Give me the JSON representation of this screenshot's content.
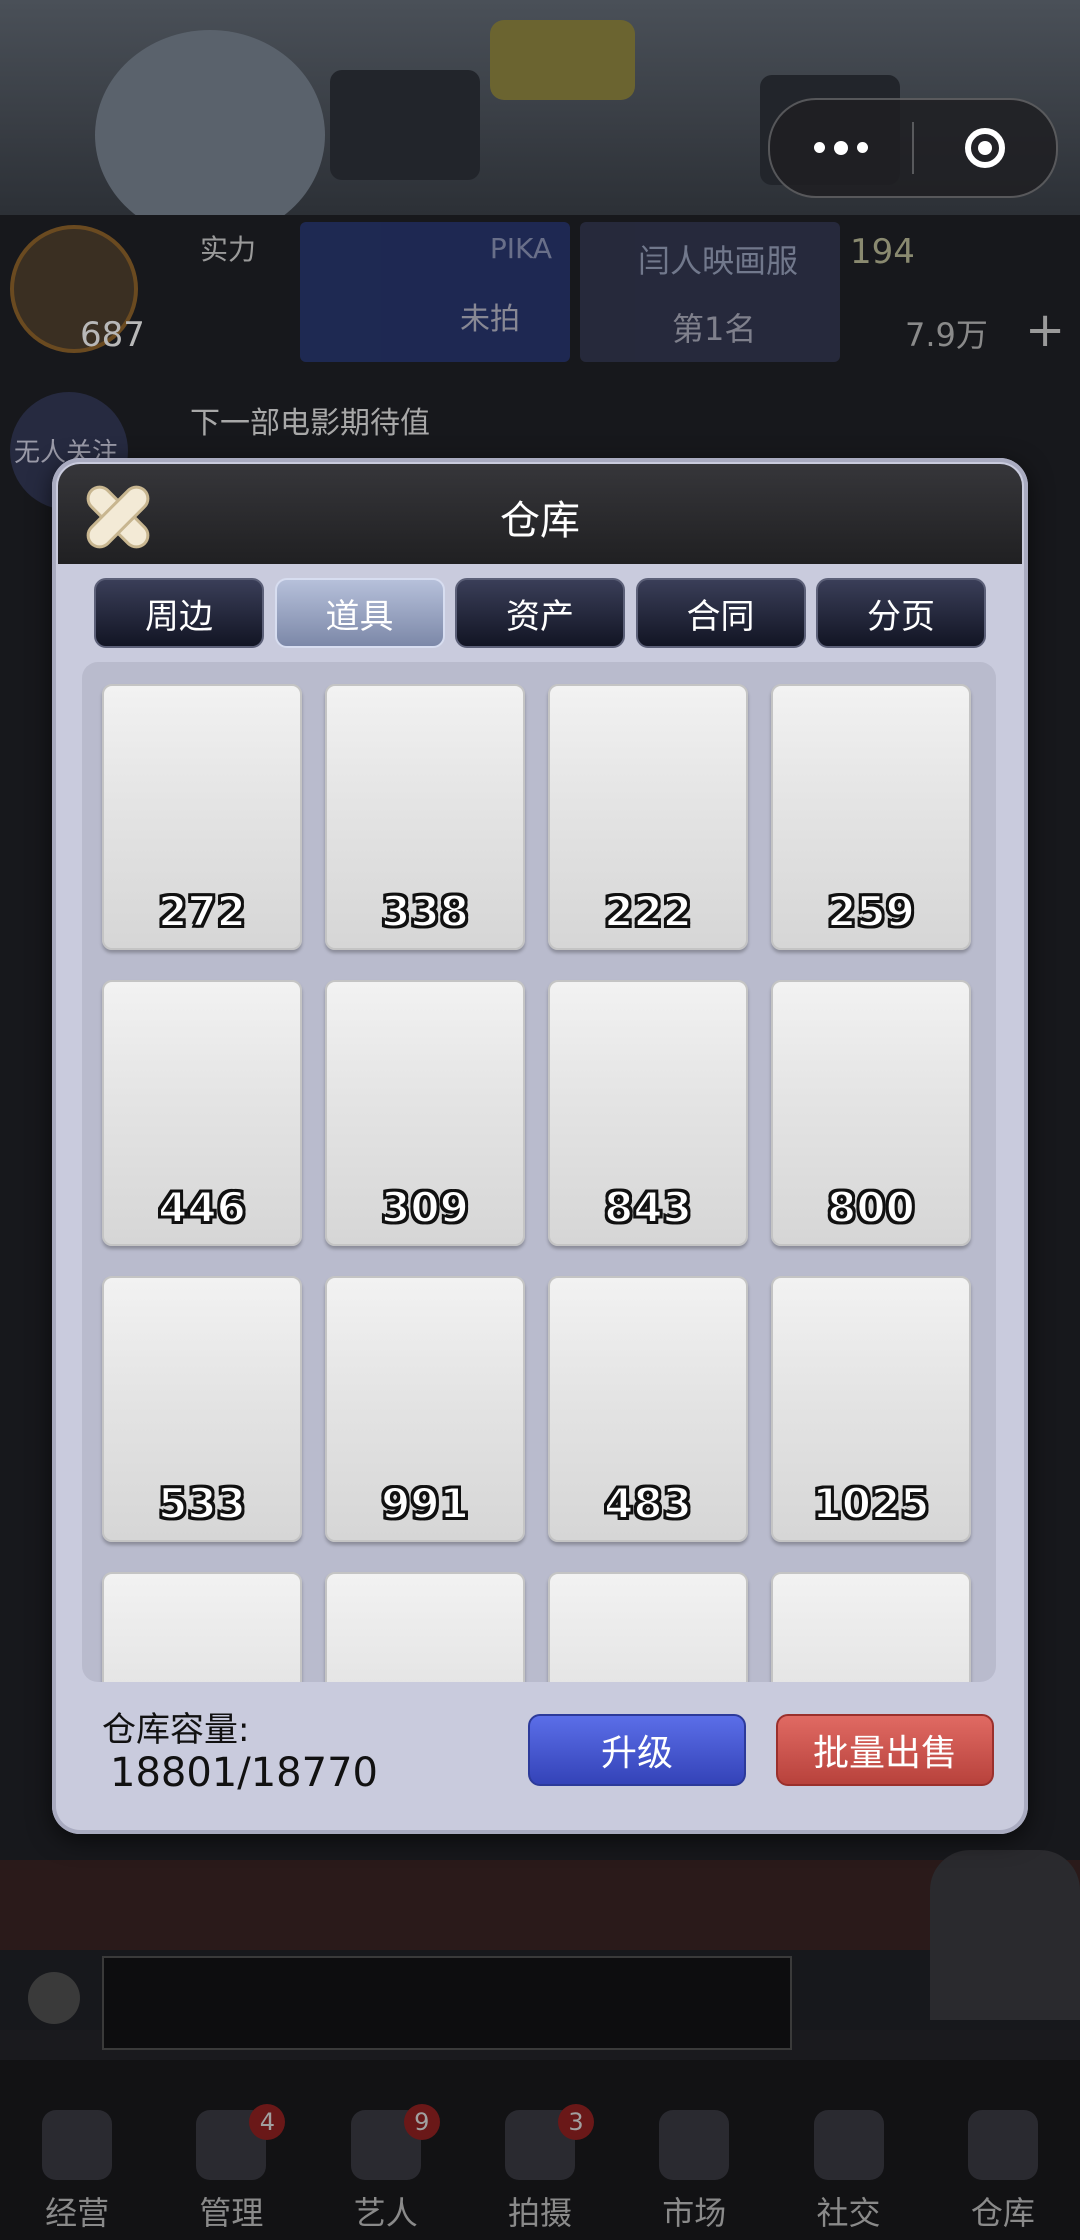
{
  "background": {
    "hud": {
      "avatar_level": "687",
      "strength_label": "实力",
      "project_title": "PIKA",
      "project_status": "未拍",
      "ranking_title": "闫人映画服",
      "ranking_value": "第1名",
      "resource_coins": "194",
      "resource_gems": "7.9万",
      "follow_label": "无人关注",
      "next_movie_text": "下一部电影期待值"
    }
  },
  "dialog": {
    "title": "仓库",
    "tabs": [
      {
        "label": "周边",
        "active": false
      },
      {
        "label": "道具",
        "active": true
      },
      {
        "label": "资产",
        "active": false
      },
      {
        "label": "合同",
        "active": false
      },
      {
        "label": "分页",
        "active": false
      }
    ],
    "items": [
      {
        "count": "272"
      },
      {
        "count": "338"
      },
      {
        "count": "222"
      },
      {
        "count": "259"
      },
      {
        "count": "446"
      },
      {
        "count": "309"
      },
      {
        "count": "843"
      },
      {
        "count": "800"
      },
      {
        "count": "533"
      },
      {
        "count": "991"
      },
      {
        "count": "483"
      },
      {
        "count": "1025"
      },
      {
        "count": ""
      },
      {
        "count": ""
      },
      {
        "count": ""
      },
      {
        "count": ""
      }
    ],
    "capacity_label": "仓库容量:",
    "capacity_value": "18801/18770",
    "upgrade_label": "升级",
    "bulk_sell_label": "批量出售"
  },
  "nav": {
    "items": [
      {
        "label": "经营",
        "badge": "",
        "icon": "shop-icon"
      },
      {
        "label": "管理",
        "badge": "4",
        "icon": "manage-icon"
      },
      {
        "label": "艺人",
        "badge": "9",
        "icon": "artist-icon"
      },
      {
        "label": "拍摄",
        "badge": "3",
        "icon": "camera-icon"
      },
      {
        "label": "市场",
        "badge": "",
        "icon": "market-icon"
      },
      {
        "label": "社交",
        "badge": "",
        "icon": "social-icon"
      },
      {
        "label": "仓库",
        "badge": "",
        "icon": "warehouse-icon"
      }
    ]
  }
}
